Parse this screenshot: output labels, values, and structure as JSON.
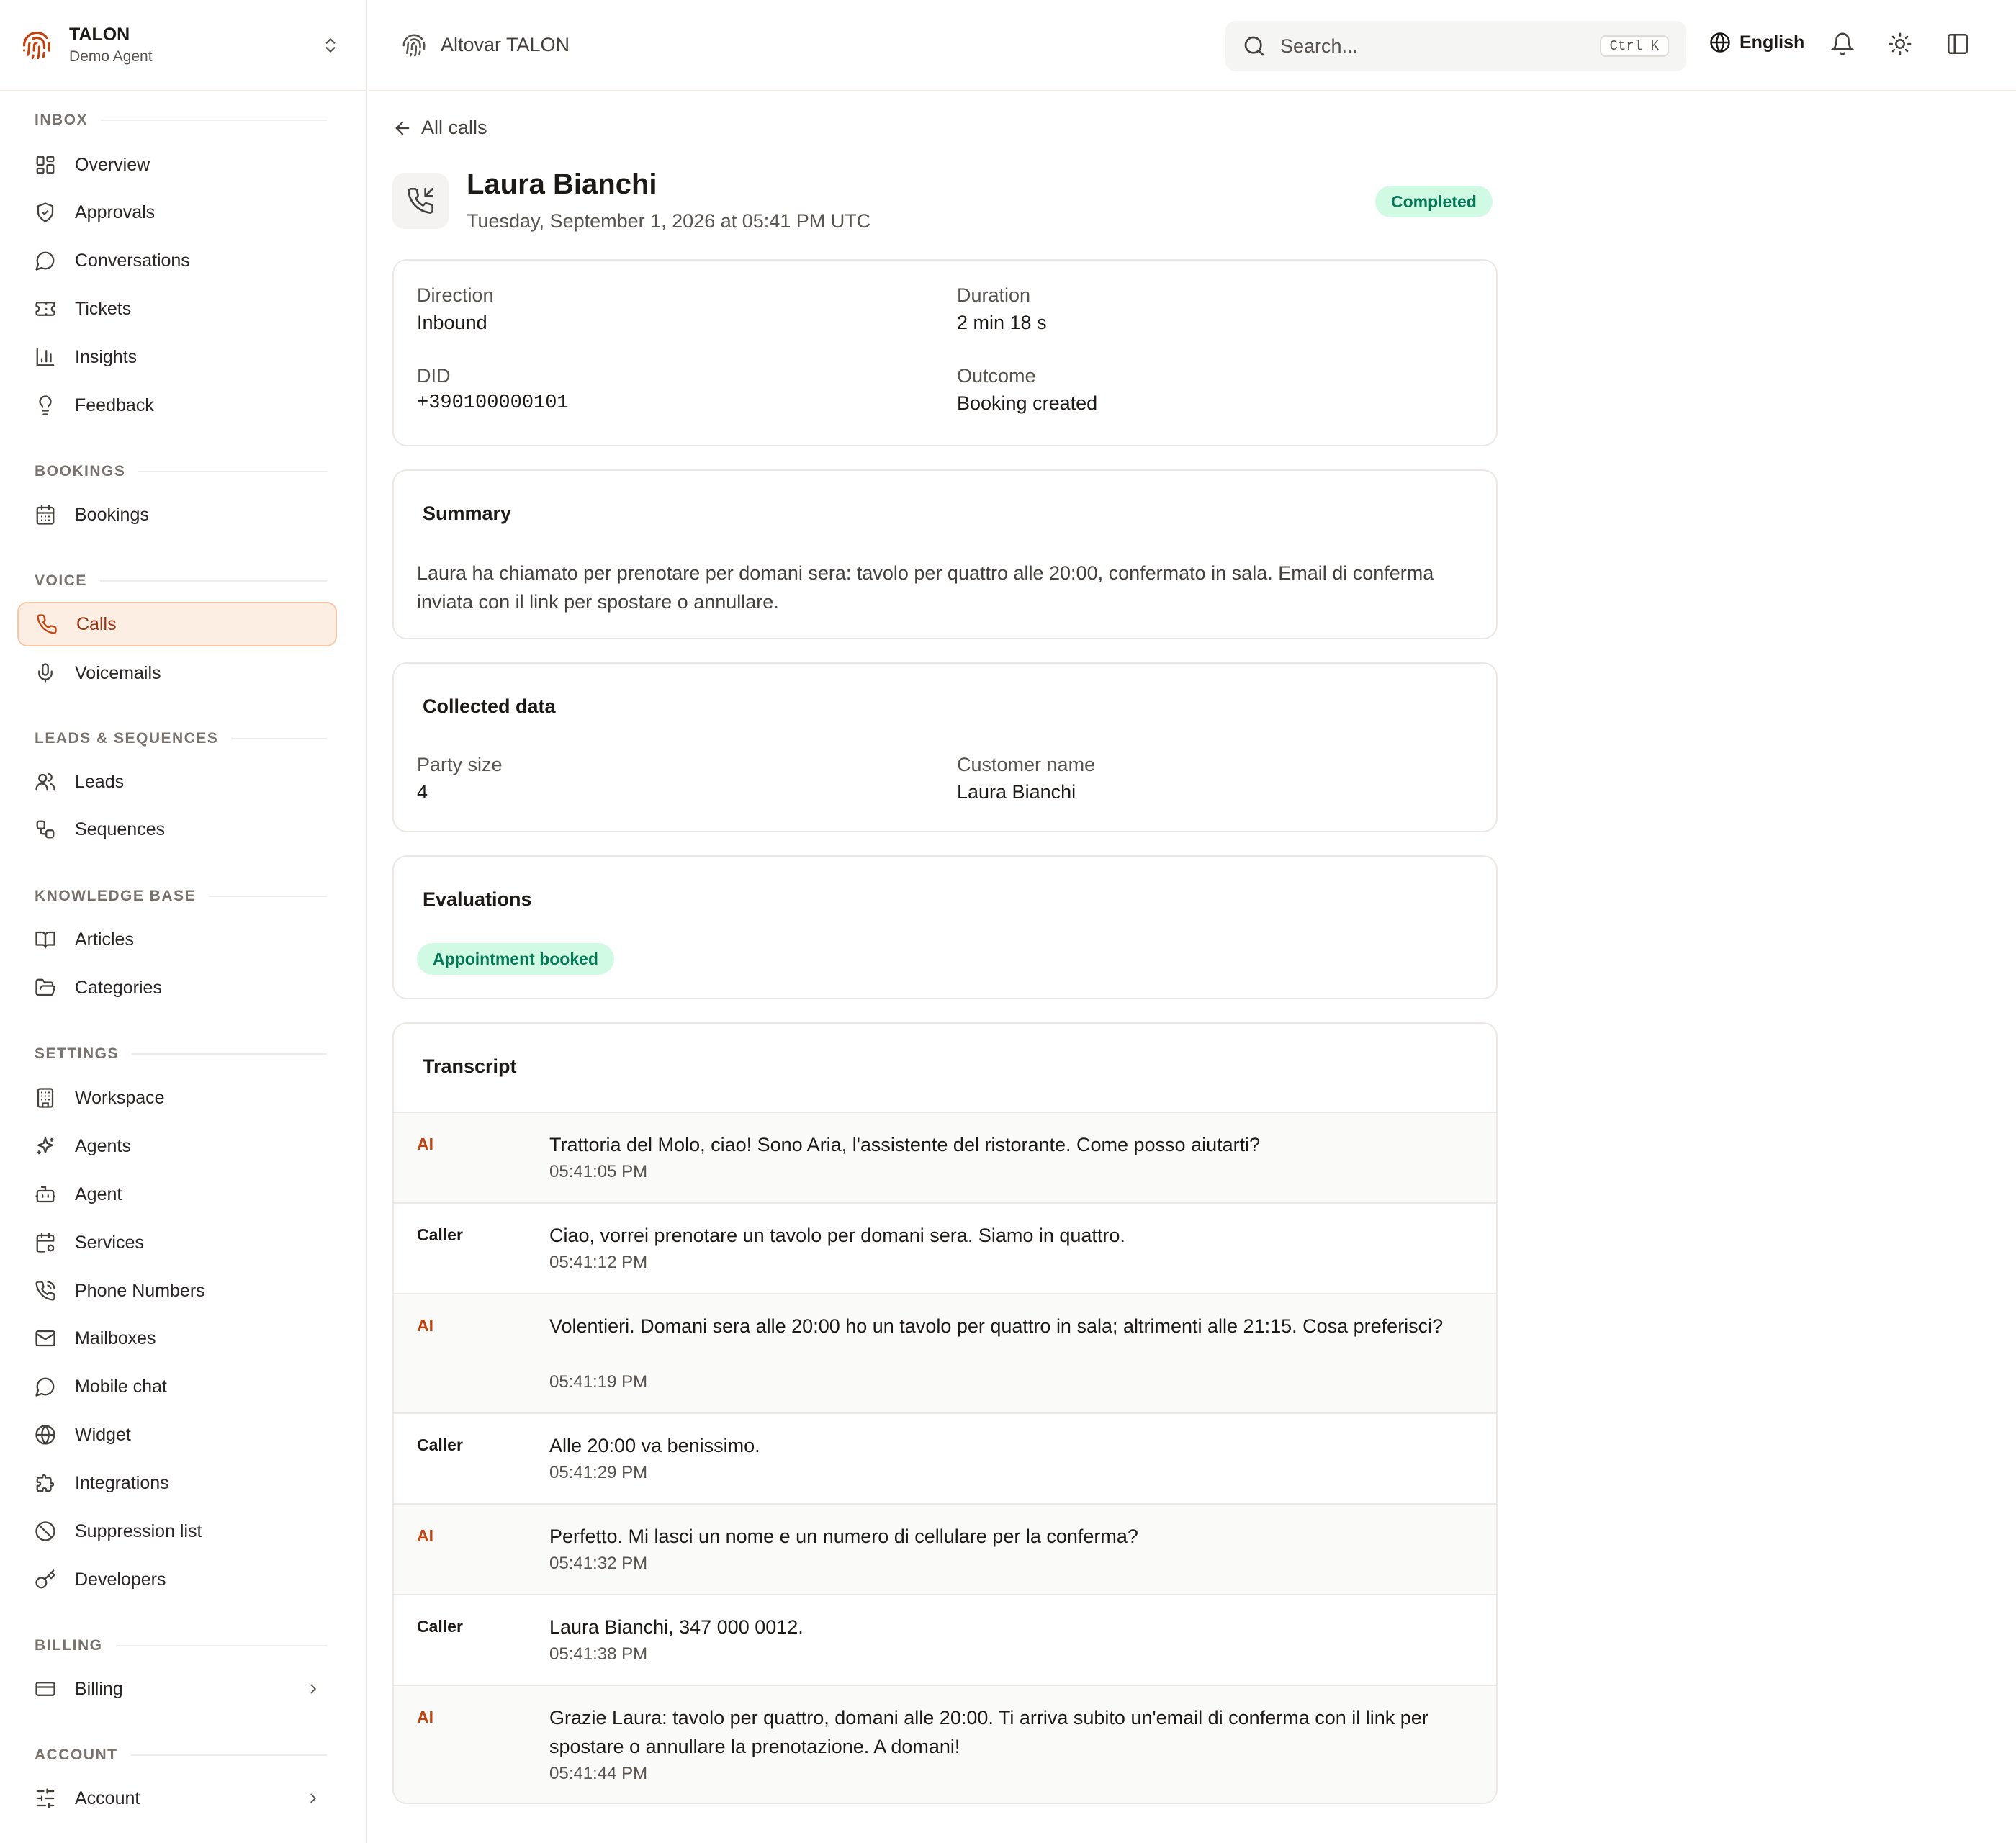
{
  "brand": {
    "name": "TALON",
    "subtitle": "Demo Agent"
  },
  "header": {
    "workspace": "Altovar TALON",
    "search_placeholder": "Search...",
    "search_shortcut": "Ctrl K",
    "language": "English"
  },
  "sidebar": {
    "inbox": {
      "title": "INBOX",
      "items": [
        "Overview",
        "Approvals",
        "Conversations",
        "Tickets",
        "Insights",
        "Feedback"
      ]
    },
    "bookings": {
      "title": "BOOKINGS",
      "items": [
        "Bookings"
      ]
    },
    "voice": {
      "title": "VOICE",
      "items": [
        "Calls",
        "Voicemails"
      ]
    },
    "leads": {
      "title": "LEADS & SEQUENCES",
      "items": [
        "Leads",
        "Sequences"
      ]
    },
    "kb": {
      "title": "KNOWLEDGE BASE",
      "items": [
        "Articles",
        "Categories"
      ]
    },
    "settings": {
      "title": "SETTINGS",
      "items": [
        "Workspace",
        "Agents",
        "Agent",
        "Services",
        "Phone Numbers",
        "Mailboxes",
        "Mobile chat",
        "Widget",
        "Integrations",
        "Suppression list",
        "Developers"
      ]
    },
    "billing": {
      "title": "BILLING",
      "items": [
        "Billing"
      ]
    },
    "account": {
      "title": "ACCOUNT",
      "items": [
        "Account"
      ]
    }
  },
  "page": {
    "back_label": "All calls",
    "caller_name": "Laura Bianchi",
    "date": "Tuesday, September 1, 2026 at 05:41 PM UTC",
    "status": "Completed"
  },
  "details": {
    "direction_label": "Direction",
    "direction": "Inbound",
    "duration_label": "Duration",
    "duration": "2 min 18 s",
    "did_label": "DID",
    "did": "+390100000101",
    "outcome_label": "Outcome",
    "outcome": "Booking created"
  },
  "summary": {
    "title": "Summary",
    "text": "Laura ha chiamato per prenotare per domani sera: tavolo per quattro alle 20:00, confermato in sala. Email di conferma inviata con il link per spostare o annullare."
  },
  "collected": {
    "title": "Collected data",
    "party_size_label": "Party size",
    "party_size": "4",
    "customer_name_label": "Customer name",
    "customer_name": "Laura Bianchi"
  },
  "evaluations": {
    "title": "Evaluations",
    "badge": "Appointment booked"
  },
  "transcript": {
    "title": "Transcript",
    "messages": [
      {
        "speaker": "AI",
        "text": "Trattoria del Molo, ciao! Sono Aria, l'assistente del ristorante. Come posso aiutarti?",
        "time": "05:41:05 PM"
      },
      {
        "speaker": "Caller",
        "text": "Ciao, vorrei prenotare un tavolo per domani sera. Siamo in quattro.",
        "time": "05:41:12 PM"
      },
      {
        "speaker": "AI",
        "text": "Volentieri. Domani sera alle 20:00 ho un tavolo per quattro in sala; altrimenti alle 21:15. Cosa preferisci?",
        "time": "05:41:19 PM"
      },
      {
        "speaker": "Caller",
        "text": "Alle 20:00 va benissimo.",
        "time": "05:41:29 PM"
      },
      {
        "speaker": "AI",
        "text": "Perfetto. Mi lasci un nome e un numero di cellulare per la conferma?",
        "time": "05:41:32 PM"
      },
      {
        "speaker": "Caller",
        "text": "Laura Bianchi, 347 000 0012.",
        "time": "05:41:38 PM"
      },
      {
        "speaker": "AI",
        "text": "Grazie Laura: tavolo per quattro, domani alle 20:00. Ti arriva subito un'email di conferma con il link per spostare o annullare la prenotazione. A domani!",
        "time": "05:41:44 PM"
      }
    ]
  }
}
